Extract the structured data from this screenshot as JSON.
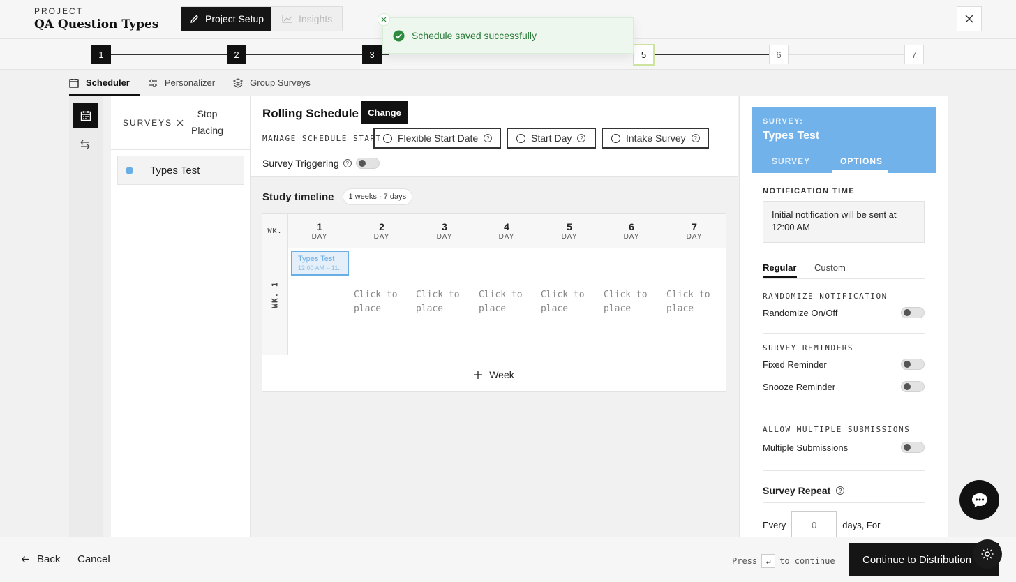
{
  "header": {
    "project_label": "PROJECT",
    "project_title": "QA Question Types",
    "mode_setup": "Project Setup",
    "mode_insights": "Insights"
  },
  "toast": {
    "message": "Schedule saved successfully"
  },
  "stepper": {
    "steps": [
      "1",
      "2",
      "3",
      "5",
      "6",
      "7"
    ],
    "current": "5"
  },
  "tabs": [
    "Scheduler",
    "Personalizer",
    "Group Surveys"
  ],
  "surveys_panel": {
    "label": "SURVEYS",
    "stop_placing": "Stop Placing",
    "items": [
      {
        "name": "Types Test",
        "color": "#6aaee6"
      }
    ]
  },
  "schedule": {
    "title": "Rolling Schedule",
    "change_label": "Change",
    "manage_start_label": "MANAGE SCHEDULE START",
    "options": [
      "Flexible Start Date",
      "Start Day",
      "Intake Survey"
    ],
    "survey_triggering": "Survey Triggering"
  },
  "timeline": {
    "title": "Study timeline",
    "badge": "1 weeks · 7 days",
    "week_header": "WK.",
    "days": [
      "1",
      "2",
      "3",
      "4",
      "5",
      "6",
      "7"
    ],
    "day_label": "DAY",
    "week_label": "WK. 1",
    "placed": {
      "name": "Types Test",
      "time": "12:00 AM – 11..."
    },
    "click_to_place": "Click to place",
    "add_week": "Week"
  },
  "right_panel": {
    "survey_label": "SURVEY:",
    "survey_name": "Types Test",
    "tab_survey": "SURVEY",
    "tab_options": "OPTIONS",
    "notification_time_label": "NOTIFICATION TIME",
    "notification_text": "Initial notification will be sent at 12:00 AM",
    "subtab_regular": "Regular",
    "subtab_custom": "Custom",
    "randomize_section": "RANDOMIZE NOTIFICATION",
    "randomize_toggle": "Randomize On/Off",
    "reminders_section": "SURVEY REMINDERS",
    "fixed_reminder": "Fixed Reminder",
    "snooze_reminder": "Snooze Reminder",
    "multiple_section": "ALLOW MULTIPLE SUBMISSIONS",
    "multiple_submissions": "Multiple Submissions",
    "repeat_title": "Survey Repeat",
    "every": "Every",
    "every_placeholder": "0",
    "days_for": "days, For"
  },
  "footer": {
    "back": "Back",
    "cancel": "Cancel",
    "press": "Press",
    "enter_key": "↵",
    "to_continue": "to continue",
    "continue_label": "Continue to Distribution"
  }
}
